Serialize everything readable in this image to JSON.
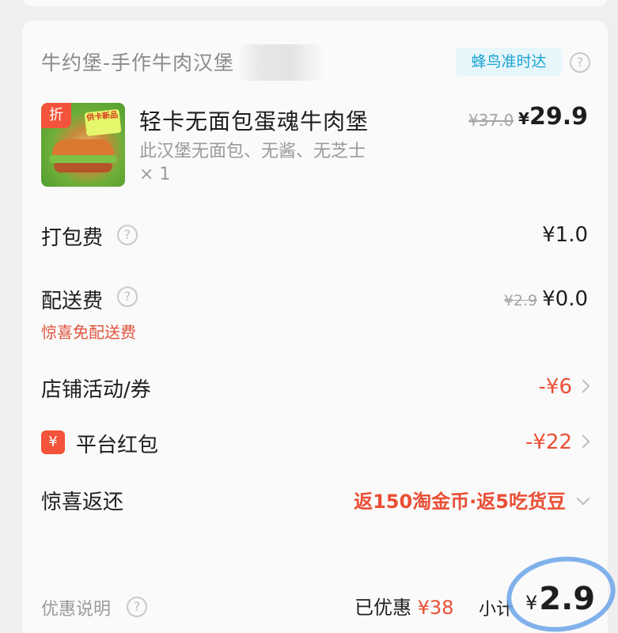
{
  "shop": {
    "name": "牛约堡-手作牛肉汉堡",
    "delivery_tag": "蜂鸟准时达"
  },
  "product": {
    "badge": "折",
    "image_label": "供卡新品",
    "name": "轻卡无面包蛋魂牛肉堡",
    "desc": "此汉堡无面包、无酱、无芝士",
    "qty": "× 1",
    "orig_price": "¥37.0",
    "price_symbol": "¥",
    "price": "29.9"
  },
  "fees": {
    "packing_label": "打包费",
    "packing_value": "¥1.0",
    "delivery_label": "配送费",
    "delivery_orig": "¥2.9",
    "delivery_value": "¥0.0",
    "delivery_note": "惊喜免配送费"
  },
  "discounts": {
    "store_label": "店铺活动/券",
    "store_value": "-¥6",
    "platform_icon": "¥",
    "platform_label": "平台红包",
    "platform_value": "-¥22",
    "surprise_label": "惊喜返还",
    "surprise_value": "返150淘金币·返5吃货豆"
  },
  "summary": {
    "note_label": "优惠说明",
    "saved_label": "已优惠",
    "saved_value": "¥38",
    "subtotal_label": "小计",
    "total_symbol": "¥",
    "total": "2.9"
  },
  "colors": {
    "accent_red": "#ea4f35",
    "delivery_blue": "#1aa3d3",
    "annotation_circle": "#6aa3e8"
  }
}
